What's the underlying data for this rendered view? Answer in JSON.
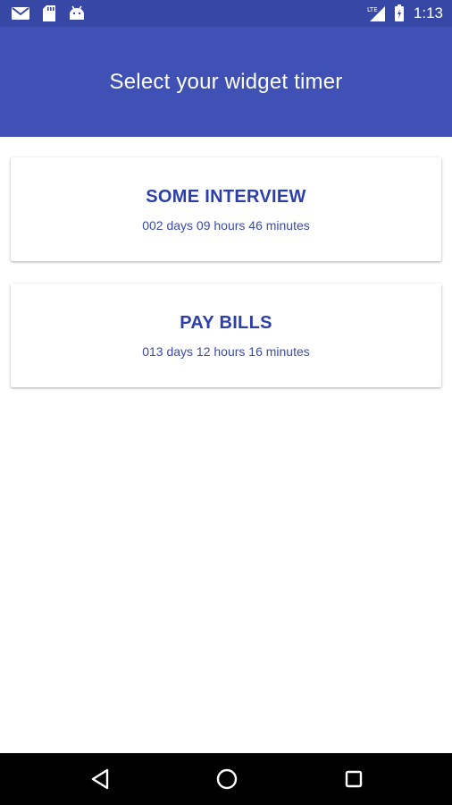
{
  "status_bar": {
    "icons_left": [
      "mail-icon",
      "sd-card-icon",
      "android-icon"
    ],
    "network_label": "LTE",
    "time": "1:13",
    "color": "#3747a6"
  },
  "app_bar": {
    "title": "Select your widget timer",
    "color": "#3f51b5"
  },
  "timers": [
    {
      "name": "SOME INTERVIEW",
      "remaining": "002 days 09 hours 46 minutes"
    },
    {
      "name": "PAY BILLS",
      "remaining": "013 days 12 hours 16 minutes"
    }
  ],
  "nav_bar": {
    "buttons": [
      "back-icon",
      "home-icon",
      "recents-icon"
    ]
  },
  "colors": {
    "accent_text": "#2c3fa8"
  }
}
